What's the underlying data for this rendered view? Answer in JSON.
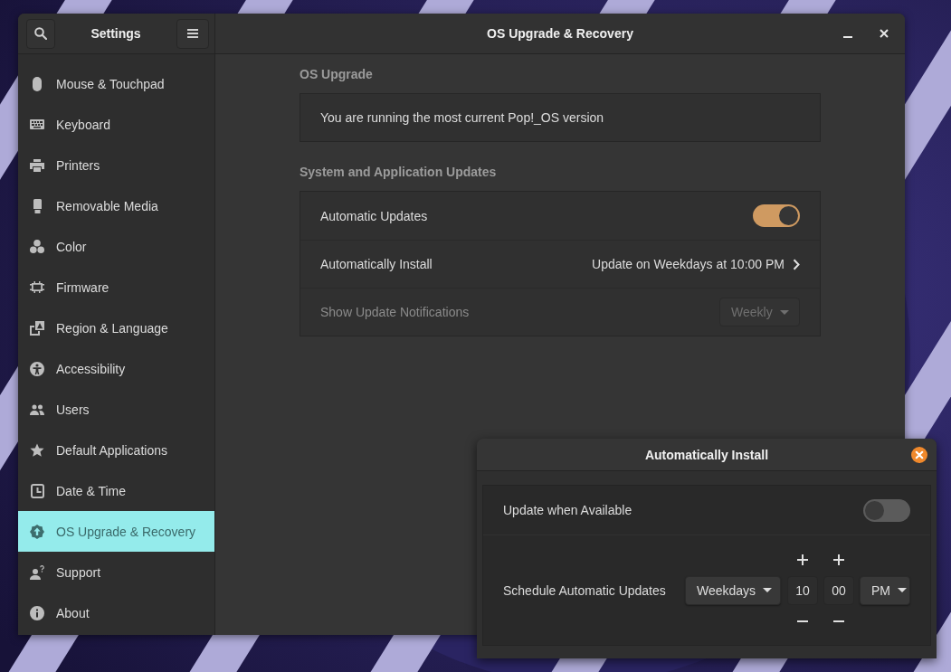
{
  "window": {
    "title": "OS Upgrade & Recovery"
  },
  "sidebar": {
    "title": "Settings",
    "items": [
      {
        "label": "Mouse & Touchpad",
        "selected": false
      },
      {
        "label": "Keyboard",
        "selected": false
      },
      {
        "label": "Printers",
        "selected": false
      },
      {
        "label": "Removable Media",
        "selected": false
      },
      {
        "label": "Color",
        "selected": false
      },
      {
        "label": "Firmware",
        "selected": false
      },
      {
        "label": "Region & Language",
        "selected": false
      },
      {
        "label": "Accessibility",
        "selected": false
      },
      {
        "label": "Users",
        "selected": false
      },
      {
        "label": "Default Applications",
        "selected": false
      },
      {
        "label": "Date & Time",
        "selected": false
      },
      {
        "label": "OS Upgrade & Recovery",
        "selected": true
      },
      {
        "label": "Support",
        "selected": false
      },
      {
        "label": "About",
        "selected": false
      }
    ]
  },
  "sections": [
    {
      "heading": "OS Upgrade",
      "rows": [
        {
          "kind": "text",
          "label": "You are running the most current Pop!_OS version",
          "disabled": false
        }
      ]
    },
    {
      "heading": "System and Application Updates",
      "rows": [
        {
          "kind": "switch",
          "label": "Automatic Updates",
          "on": true,
          "disabled": false
        },
        {
          "kind": "link",
          "label": "Automatically Install",
          "value": "Update on Weekdays at 10:00 PM",
          "disabled": false
        },
        {
          "kind": "dropdown",
          "label": "Show Update Notifications",
          "value": "Weekly",
          "disabled": true
        }
      ]
    }
  ],
  "dialog": {
    "title": "Automatically Install",
    "rows": [
      {
        "kind": "switch",
        "label": "Update when Available",
        "on": false
      },
      {
        "kind": "schedule",
        "label": "Schedule Automatic Updates",
        "day": "Weekdays",
        "hour": "10",
        "minute": "00",
        "period": "PM"
      }
    ]
  }
}
